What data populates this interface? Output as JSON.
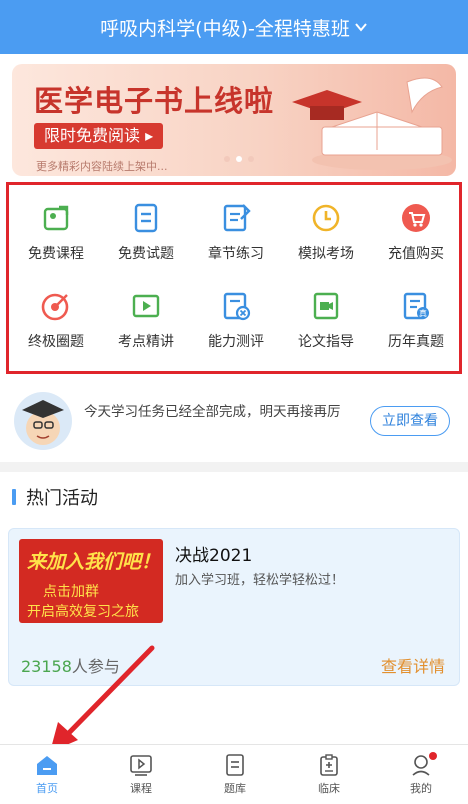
{
  "header": {
    "title": "呼吸内科学(中级)-全程特惠班"
  },
  "banner": {
    "title": "医学电子书上线啦",
    "pill": "限时免费阅读 ▸",
    "sub": "更多精彩内容陆续上架中..."
  },
  "features": [
    {
      "label": "免费课程",
      "icon": "free-course-icon",
      "color": "#4caf50"
    },
    {
      "label": "免费试题",
      "icon": "free-exam-icon",
      "color": "#3a8fe0"
    },
    {
      "label": "章节练习",
      "icon": "chapter-practice-icon",
      "color": "#3a8fe0"
    },
    {
      "label": "模拟考场",
      "icon": "mock-exam-clock-icon",
      "color": "#f0b429"
    },
    {
      "label": "充值购买",
      "icon": "cart-icon",
      "color": "#ef5a50"
    },
    {
      "label": "终极圈题",
      "icon": "target-icon",
      "color": "#ef5a50"
    },
    {
      "label": "考点精讲",
      "icon": "video-icon",
      "color": "#4caf50"
    },
    {
      "label": "能力测评",
      "icon": "assessment-icon",
      "color": "#3a8fe0"
    },
    {
      "label": "论文指导",
      "icon": "paper-video-icon",
      "color": "#4caf50"
    },
    {
      "label": "历年真题",
      "icon": "past-exams-icon",
      "color": "#3a8fe0"
    }
  ],
  "task": {
    "message": "今天学习任务已经全部完成，明天再接再厉",
    "button": "立即查看"
  },
  "section": {
    "title": "热门活动"
  },
  "activity": {
    "thumb_line1": "来加入我们吧！",
    "thumb_line2": "点击加群",
    "thumb_line3": "开启高效复习之旅",
    "title": "决战2021",
    "desc": "加入学习班，轻松学轻松过！",
    "count": "23158",
    "count_unit": "人参与",
    "detail": "查看详情"
  },
  "tabs": [
    {
      "label": "首页",
      "icon": "home-icon",
      "active": true
    },
    {
      "label": "课程",
      "icon": "play-course-icon",
      "active": false
    },
    {
      "label": "题库",
      "icon": "question-bank-icon",
      "active": false
    },
    {
      "label": "临床",
      "icon": "clipboard-icon",
      "active": false
    },
    {
      "label": "我的",
      "icon": "profile-icon",
      "active": false
    }
  ],
  "colors": {
    "primary": "#4b9cf2",
    "highlight_border": "#e0252b",
    "arrow": "#e0252b"
  }
}
